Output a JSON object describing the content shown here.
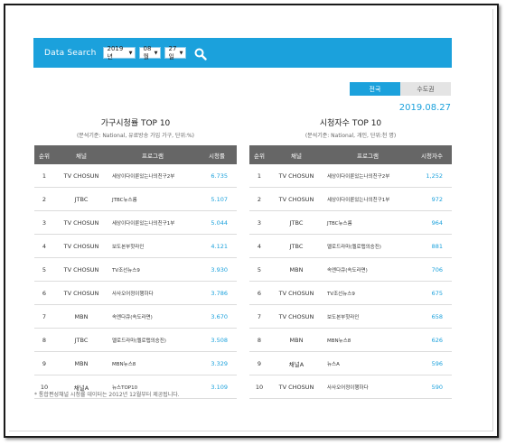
{
  "search": {
    "label": "Data Search",
    "year": "2019년",
    "month": "08월",
    "day": "27일"
  },
  "tabs": [
    {
      "label": "전국",
      "active": true
    },
    {
      "label": "수도권",
      "active": false
    }
  ],
  "date": "2019.08.27",
  "household": {
    "title": "가구시청률 TOP 10",
    "subtitle": "(분석기준: National, 유료방송 가입 가구, 단위:%)",
    "headers": [
      "순위",
      "채널",
      "프로그램",
      "시청률"
    ],
    "rows": [
      {
        "rank": "1",
        "channel": "TV CHOSUN",
        "program": "세상이다이룬있는나의친구2부",
        "value": "6.735"
      },
      {
        "rank": "2",
        "channel": "JTBC",
        "program": "JTBC뉴스룸",
        "value": "5.107"
      },
      {
        "rank": "3",
        "channel": "TV CHOSUN",
        "program": "세상이다이룬있는나의친구1부",
        "value": "5.044"
      },
      {
        "rank": "4",
        "channel": "TV CHOSUN",
        "program": "보도본부핫라인",
        "value": "4.121"
      },
      {
        "rank": "5",
        "channel": "TV CHOSUN",
        "program": "TV조선뉴스9",
        "value": "3.930"
      },
      {
        "rank": "6",
        "channel": "TV CHOSUN",
        "program": "사사오어정이행하다",
        "value": "3.786"
      },
      {
        "rank": "7",
        "channel": "MBN",
        "program": "속엔다큐(속도라면)",
        "value": "3.670"
      },
      {
        "rank": "8",
        "channel": "JTBC",
        "program": "멜로드라마(멜로탭의승진)",
        "value": "3.508"
      },
      {
        "rank": "9",
        "channel": "MBN",
        "program": "MBN뉴스8",
        "value": "3.329"
      },
      {
        "rank": "10",
        "channel": "채널A",
        "program": "뉴스TOP10",
        "value": "3.109"
      }
    ]
  },
  "viewers": {
    "title": "시청자수 TOP 10",
    "subtitle": "(분석기준: National, 개인, 단위:천 명)",
    "headers": [
      "순위",
      "채널",
      "프로그램",
      "시청자수"
    ],
    "rows": [
      {
        "rank": "1",
        "channel": "TV CHOSUN",
        "program": "세상이다이룬있는나의친구2부",
        "value": "1,252"
      },
      {
        "rank": "2",
        "channel": "TV CHOSUN",
        "program": "세상이다이룬있는나의친구1부",
        "value": "972"
      },
      {
        "rank": "3",
        "channel": "JTBC",
        "program": "JTBC뉴스룸",
        "value": "964"
      },
      {
        "rank": "4",
        "channel": "JTBC",
        "program": "멜로드라마(멜로탭의승진)",
        "value": "881"
      },
      {
        "rank": "5",
        "channel": "MBN",
        "program": "속엔다큐(속도라면)",
        "value": "706"
      },
      {
        "rank": "6",
        "channel": "TV CHOSUN",
        "program": "TV조선뉴스9",
        "value": "675"
      },
      {
        "rank": "7",
        "channel": "TV CHOSUN",
        "program": "보도본부핫라인",
        "value": "658"
      },
      {
        "rank": "8",
        "channel": "MBN",
        "program": "MBN뉴스8",
        "value": "626"
      },
      {
        "rank": "9",
        "channel": "채널A",
        "program": "뉴스A",
        "value": "596"
      },
      {
        "rank": "10",
        "channel": "TV CHOSUN",
        "program": "사사오어정이행하다",
        "value": "590"
      }
    ]
  },
  "footnote": "* 통합편성채널 시청률 데이터는 2012년 12월부터 제공됩니다.",
  "colors": {
    "accent": "#1ba1dc",
    "header_bg": "#666666"
  }
}
